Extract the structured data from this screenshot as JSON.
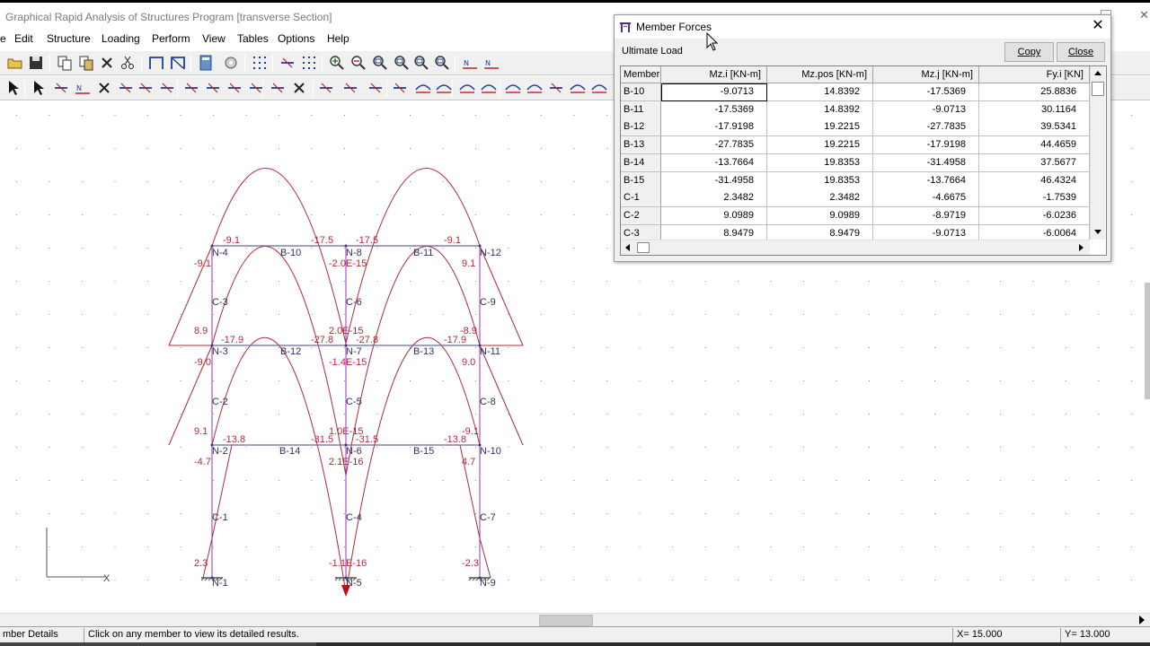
{
  "window": {
    "title": "Graphical Rapid Analysis of Structures Program [transverse Section]"
  },
  "menu": [
    "e",
    "Edit",
    "Structure",
    "Loading",
    "Perform",
    "View",
    "Tables",
    "Options",
    "Help"
  ],
  "toolbar_icons": {
    "row1": [
      "open-icon",
      "save-icon",
      "copy-icon",
      "paste-icon",
      "delete-icon",
      "cut-icon",
      "frame-icon",
      "frame-braced-icon",
      "calculator-icon",
      "settings-icon",
      "grid-dots-icon",
      "dimension-icon",
      "node-grid-icon",
      "zoom-in-icon",
      "zoom-out-icon",
      "zoom-window-icon",
      "zoom-all-icon",
      "zoom-previous-icon",
      "zoom-extents-icon",
      "node-numbers-icon",
      "element-numbers-icon"
    ],
    "row2": [
      "select-icon",
      "pointer-icon",
      "draw-member-icon",
      "member-numbers-icon",
      "cross-icon",
      "support-fixed-icon",
      "brace-icon",
      "columns-icon",
      "hinge-icon",
      "triangle-support-icon",
      "coordinates-icon",
      "xy-icon",
      "move-icon",
      "delete-node-icon",
      "split-icon",
      "measure-icon",
      "section-icon",
      "table-icon",
      "arc-icon",
      "numbered-load-icon",
      "line-load-icon",
      "deflection-icon",
      "distributed-load-icon",
      "moment-diagram-icon",
      "bending-moment-icon",
      "shear-diagram-icon",
      "axial-diagram-icon",
      "results-icon"
    ]
  },
  "status": {
    "pane1": "mber Details",
    "pane2": "Click on any member to view its detailed results.",
    "x": "X= 15.000",
    "y": "Y= 13.000"
  },
  "axis": {
    "x_label": "X"
  },
  "diagram": {
    "member_labels": [
      "B-10",
      "B-11",
      "B-12",
      "B-13",
      "B-14",
      "B-15",
      "C-1",
      "C-2",
      "C-3",
      "C-4",
      "C-5",
      "C-6",
      "C-7",
      "C-8",
      "C-9"
    ],
    "node_labels": [
      "N-1",
      "N-2",
      "N-3",
      "N-4",
      "N-5",
      "N-6",
      "N-7",
      "N-8",
      "N-9",
      "N-10",
      "N-11",
      "N-12"
    ],
    "value_labels": [
      "-9.1",
      "-17.5",
      "-17.5",
      "-9.1",
      "-9.1",
      "-2.0E-15",
      "9.1",
      "8.9",
      "-17.9",
      "-27.8",
      "2.0E-15",
      "-27.8",
      "-17.9",
      "-8.9",
      "-9.0",
      "-1.4E-15",
      "9.0",
      "9.1",
      "-13.8",
      "-31.5",
      "1.0E-15",
      "-31.5",
      "-13.8",
      "-9.1",
      "-4.7",
      "2.1E-16",
      "4.7",
      "2.3",
      "-1.1E-16",
      "-2.3"
    ]
  },
  "dialog": {
    "title": "Member Forces",
    "subtitle": "Ultimate Load",
    "copy_label": "Copy",
    "close_label": "Close",
    "columns": [
      "Member",
      "Mz.i [KN-m]",
      "Mz.pos [KN-m]",
      "Mz.j [KN-m]",
      "Fy.i [KN]"
    ],
    "rows": [
      [
        "B-10",
        "-9.0713",
        "14.8392",
        "-17.5369",
        "25.8836"
      ],
      [
        "B-11",
        "-17.5369",
        "14.8392",
        "-9.0713",
        "30.1164"
      ],
      [
        "B-12",
        "-17.9198",
        "19.2215",
        "-27.7835",
        "39.5341"
      ],
      [
        "B-13",
        "-27.7835",
        "19.2215",
        "-17.9198",
        "44.4659"
      ],
      [
        "B-14",
        "-13.7664",
        "19.8353",
        "-31.4958",
        "37.5677"
      ],
      [
        "B-15",
        "-31.4958",
        "19.8353",
        "-13.7664",
        "46.4324"
      ],
      [
        "C-1",
        "2.3482",
        "2.3482",
        "-4.6675",
        "-1.7539"
      ],
      [
        "C-2",
        "9.0989",
        "9.0989",
        "-8.9719",
        "-6.0236"
      ],
      [
        "C-3",
        "8.9479",
        "8.9479",
        "-9.0713",
        "-6.0064"
      ]
    ]
  }
}
